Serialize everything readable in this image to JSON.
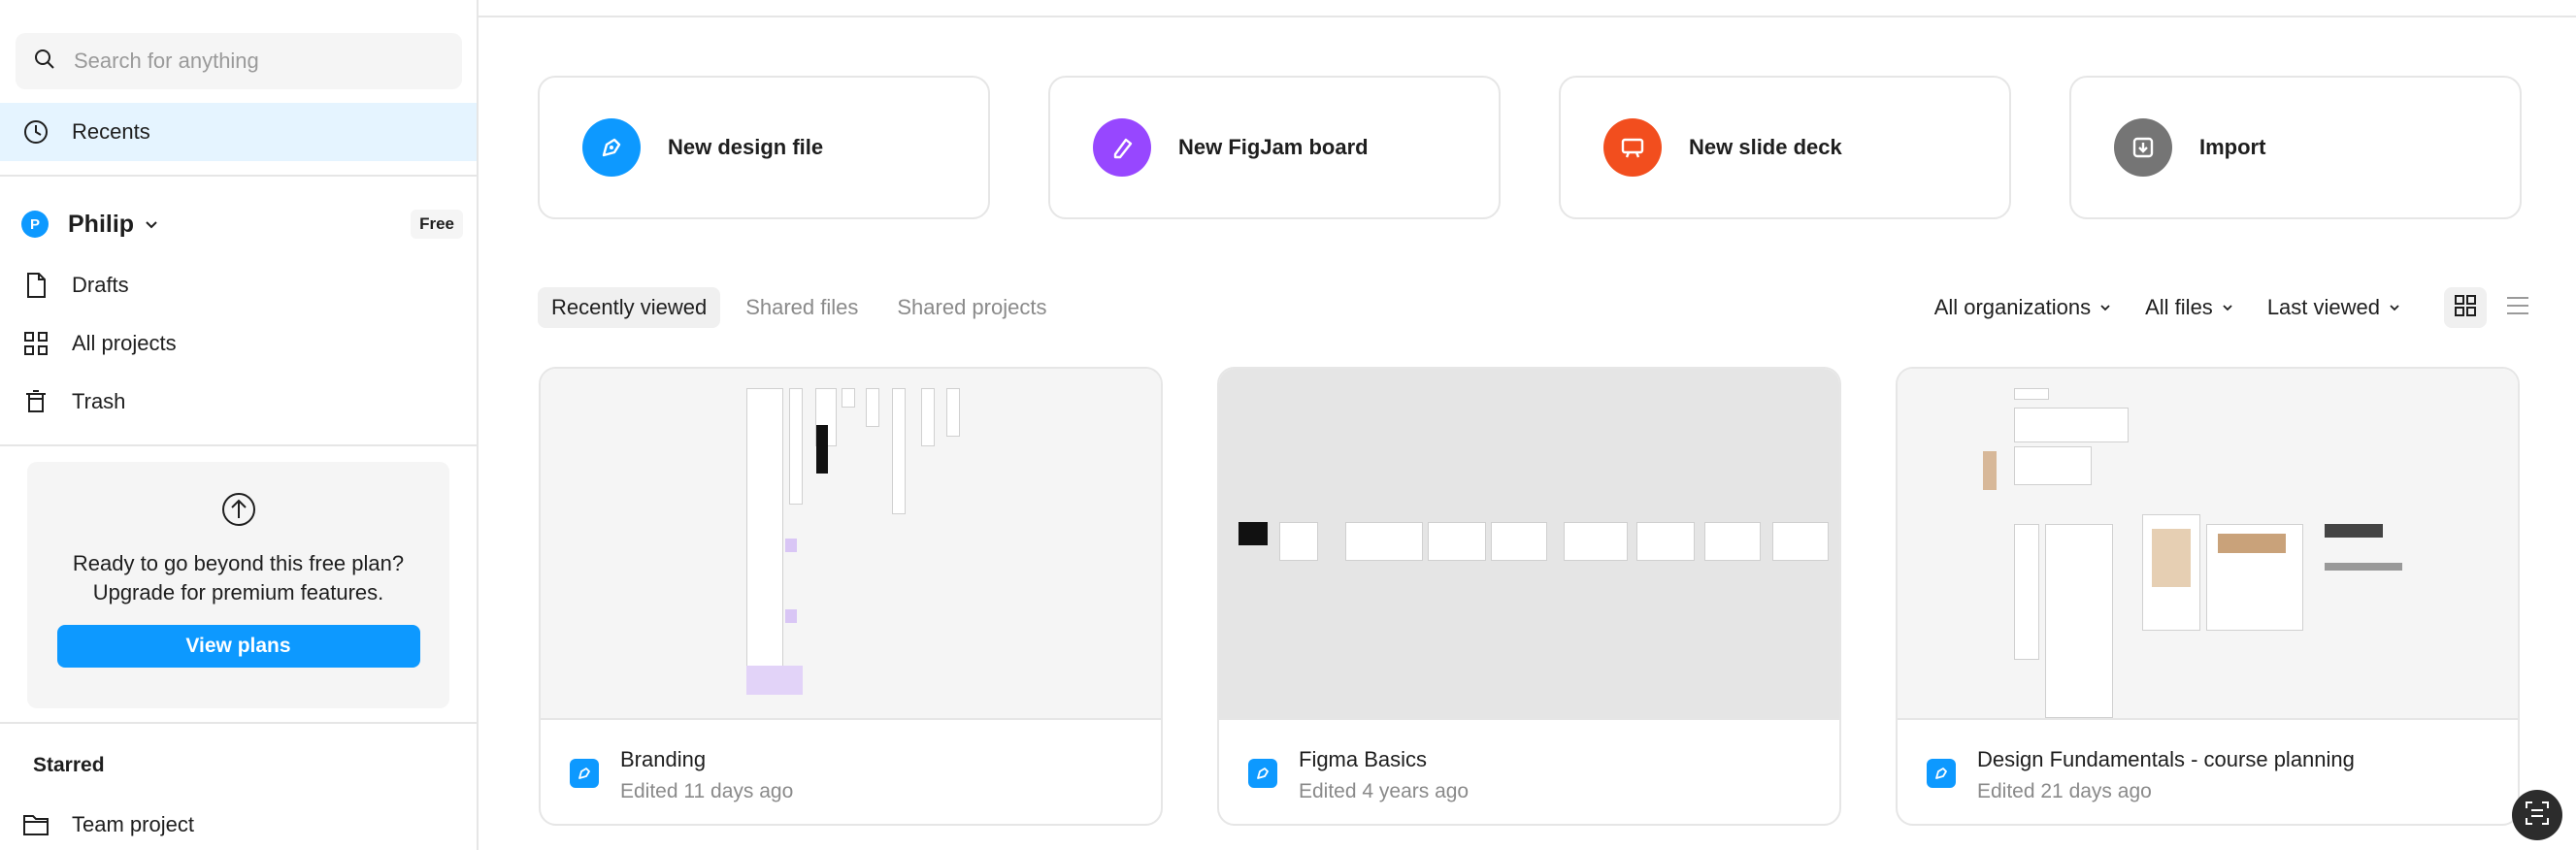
{
  "search": {
    "placeholder": "Search for anything"
  },
  "sidebar": {
    "recents_label": "Recents",
    "team": {
      "initial": "P",
      "name": "Philip",
      "plan_badge": "Free"
    },
    "items": [
      {
        "label": "Drafts"
      },
      {
        "label": "All projects"
      },
      {
        "label": "Trash"
      }
    ],
    "upsell": {
      "line1": "Ready to go beyond this free plan?",
      "line2": "Upgrade for premium features.",
      "button": "View plans"
    },
    "starred": {
      "heading": "Starred",
      "items": [
        {
          "label": "Team project"
        }
      ]
    }
  },
  "create": [
    {
      "label": "New design file",
      "color": "#0d99ff",
      "icon": "pen-icon"
    },
    {
      "label": "New FigJam board",
      "color": "#9747ff",
      "icon": "marker-icon"
    },
    {
      "label": "New slide deck",
      "color": "#f24e1e",
      "icon": "presentation-icon"
    },
    {
      "label": "Import",
      "color": "#757575",
      "icon": "import-icon"
    }
  ],
  "tabs": [
    {
      "label": "Recently viewed",
      "active": true
    },
    {
      "label": "Shared files",
      "active": false
    },
    {
      "label": "Shared projects",
      "active": false
    }
  ],
  "filters": {
    "organizations": "All organizations",
    "files": "All files",
    "sort": "Last viewed"
  },
  "files": [
    {
      "title": "Branding",
      "edited": "Edited 11 days ago"
    },
    {
      "title": "Figma Basics",
      "edited": "Edited 4 years ago"
    },
    {
      "title": "Design Fundamentals - course planning",
      "edited": "Edited 21 days ago"
    }
  ],
  "colors": {
    "accent": "#0d99ff",
    "active_bg": "#e5f4ff"
  }
}
